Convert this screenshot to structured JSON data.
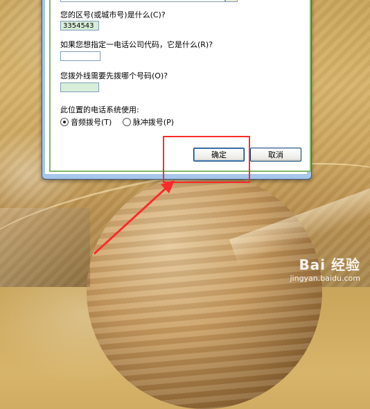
{
  "dialog": {
    "area_code_label": "您的区号(或城市号)是什么(C)?",
    "area_code_value": "3354543",
    "carrier_code_label": "如果您想指定一电话公司代码，它是什么(R)?",
    "carrier_code_value": "",
    "outside_line_label": "您拨外线需要先拨哪个号码(O)?",
    "outside_line_value": "",
    "dial_system_label": "此位置的电话系统使用:",
    "tone_label": "音频拨号(T)",
    "pulse_label": "脉冲拨号(P)",
    "selected_dialing": "tone",
    "ok_label": "确定",
    "cancel_label": "取消"
  },
  "annotation": {
    "highlight_color": "#ff2a2a"
  },
  "watermark": {
    "main": "Bai 经验",
    "sub": "jingyan.baidu.com"
  }
}
